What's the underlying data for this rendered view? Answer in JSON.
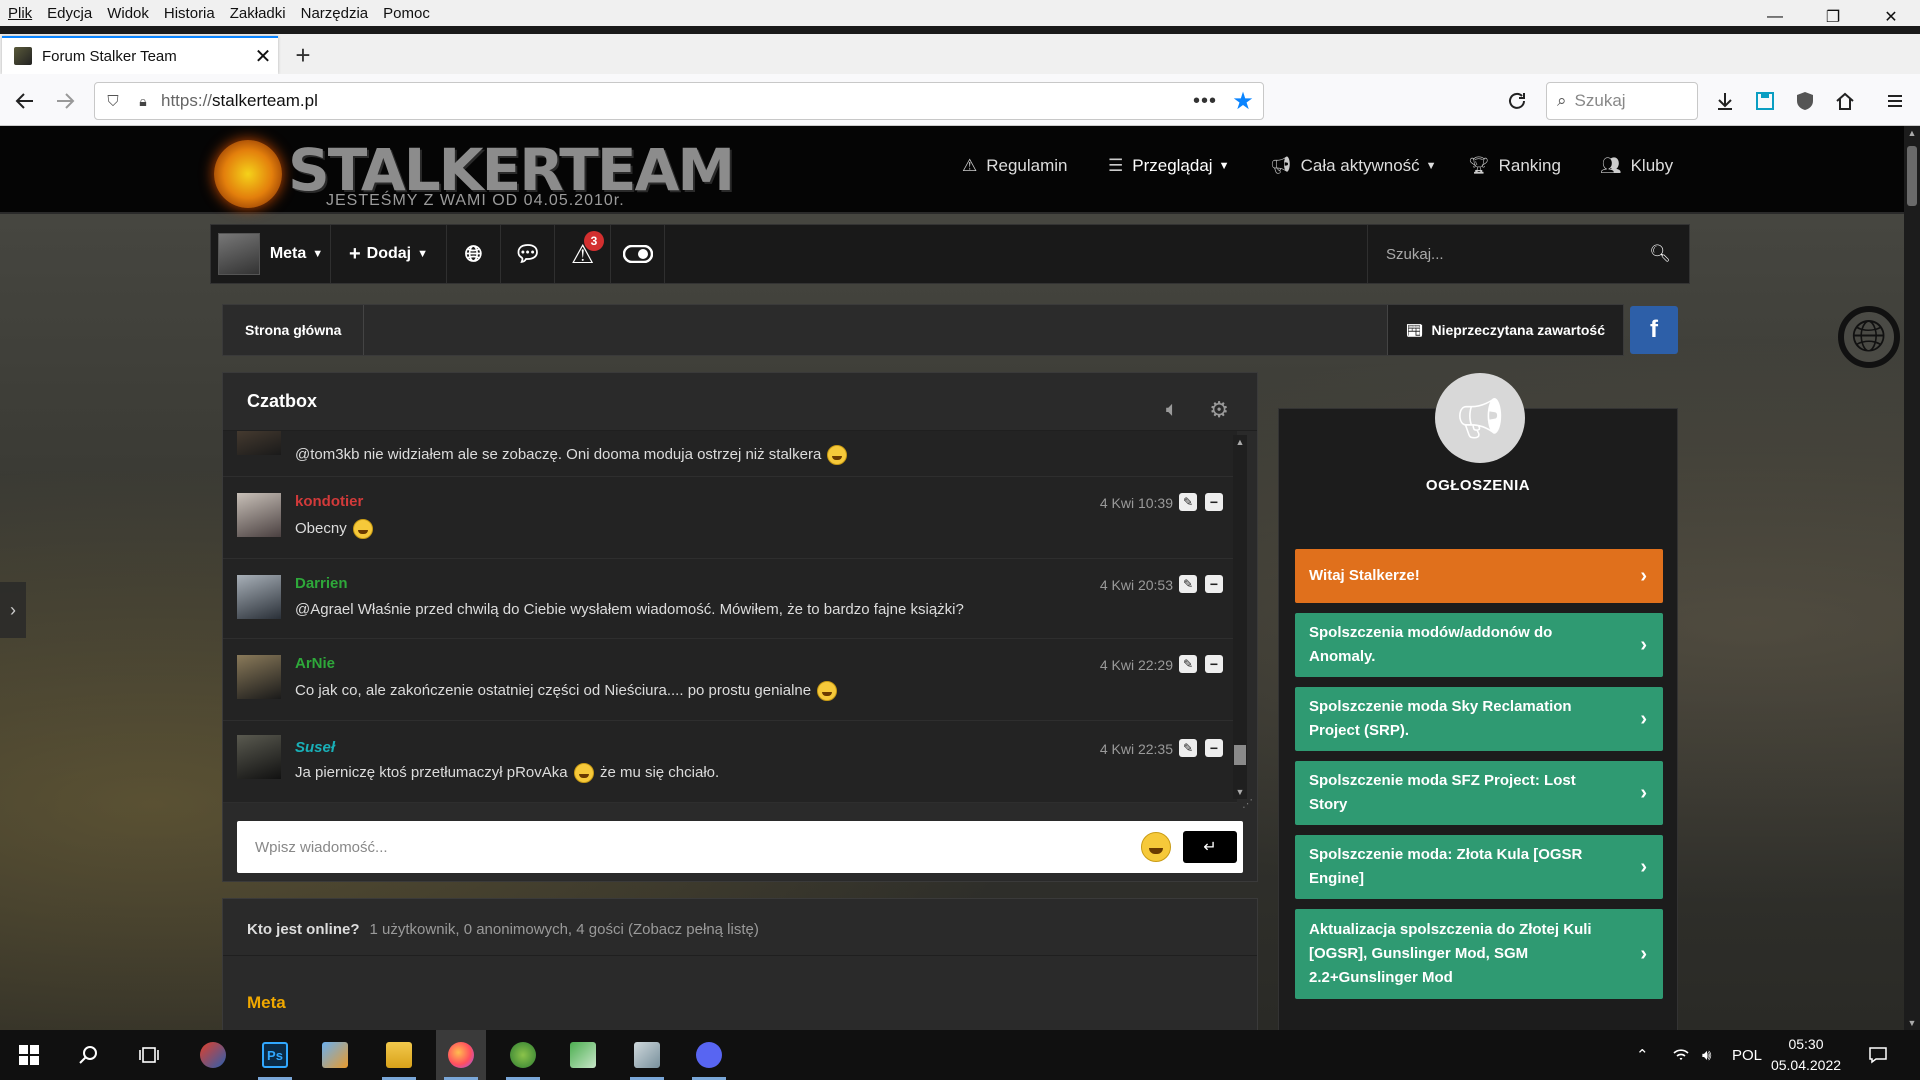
{
  "menubar": [
    "Plik",
    "Edycja",
    "Widok",
    "Historia",
    "Zakładki",
    "Narzędzia",
    "Pomoc"
  ],
  "window_controls": {
    "minimize": "—",
    "restore": "❐",
    "close": "✕"
  },
  "tab": {
    "title": "Forum Stalker Team",
    "close": "✕",
    "new": "+"
  },
  "navbar": {
    "url_proto": "https://",
    "url_host": "stalkerteam.pl",
    "dots": "•••",
    "search_placeholder": "Szukaj"
  },
  "site": {
    "logo_name": "STALKERTEAM",
    "logo_tagline": "JESTEŚMY Z WAMI OD 04.05.2010r.",
    "nav": [
      {
        "label": "Regulamin",
        "icon": "warning-icon"
      },
      {
        "label": "Przeglądaj",
        "icon": "list-icon"
      },
      {
        "label": "Cała aktywność",
        "icon": "megaphone-icon"
      },
      {
        "label": "Ranking",
        "icon": "trophy-icon"
      },
      {
        "label": "Kluby",
        "icon": "users-icon"
      }
    ]
  },
  "userbar": {
    "user": "Meta",
    "add": "Dodaj",
    "notifications_count": "3",
    "search_placeholder": "Szukaj..."
  },
  "breadcrumb": {
    "home": "Strona główna",
    "unread": "Nieprzeczytana zawartość",
    "facebook": "f"
  },
  "chatbox": {
    "title": "Czatbox",
    "messages": [
      {
        "user": "",
        "color": "#cccccc",
        "time": "",
        "text_before": "@tom3kb nie widziałem ale se zobaczę. Oni dooma moduja ostrzej niż stalkera",
        "text_after": ""
      },
      {
        "user": "kondotier",
        "color": "#d23a3a",
        "time": "4 Kwi 10:39",
        "text_before": "Obecny",
        "text_after": ""
      },
      {
        "user": "Darrien",
        "color": "#2ea83a",
        "time": "4 Kwi 20:53",
        "text_before": "@Agrael Właśnie przed chwilą do Ciebie wysłałem wiadomość. Mówiłem, że to bardzo fajne książki?",
        "text_after": ""
      },
      {
        "user": "ArNie",
        "color": "#2ea83a",
        "time": "4 Kwi 22:29",
        "text_before": "Co jak co, ale zakończenie ostatniej części od Nieściura.... po prostu genialne",
        "text_after": ""
      },
      {
        "user": "Suseł",
        "color": "#19b0b8",
        "time": "4 Kwi 22:35",
        "text_before": "Ja pierniczę ktoś przetłumaczył pRovAka",
        "text_after": "że mu się chciało."
      }
    ],
    "input_placeholder": "Wpisz wiadomość...",
    "send": "↵"
  },
  "online": {
    "label": "Kto jest online?",
    "summary": "1 użytkownik, 0 anonimowych, 4 gości (Zobacz pełną listę)",
    "group": "Meta"
  },
  "announcements": {
    "title": "OGŁOSZENIA",
    "items": [
      {
        "label": "Witaj Stalkerze!",
        "color": "#e0701c"
      },
      {
        "label": "Spolszczenia modów/addonów do Anomaly.",
        "color": "#2f9a72"
      },
      {
        "label": "Spolszczenie moda Sky Reclamation Project (SRP).",
        "color": "#2f9a72"
      },
      {
        "label": "Spolszczenie moda SFZ Project: Lost Story",
        "color": "#2f9a72"
      },
      {
        "label": "Spolszczenie moda: Złota Kula [OGSR Engine]",
        "color": "#2f9a72"
      },
      {
        "label": "Aktualizacja spolszczenia do Złotej Kuli [OGSR], Gunslinger Mod, SGM 2.2+Gunslinger Mod",
        "color": "#2f9a72"
      }
    ]
  },
  "taskbar": {
    "language": "POL",
    "time": "05:30",
    "date": "05.04.2022"
  }
}
